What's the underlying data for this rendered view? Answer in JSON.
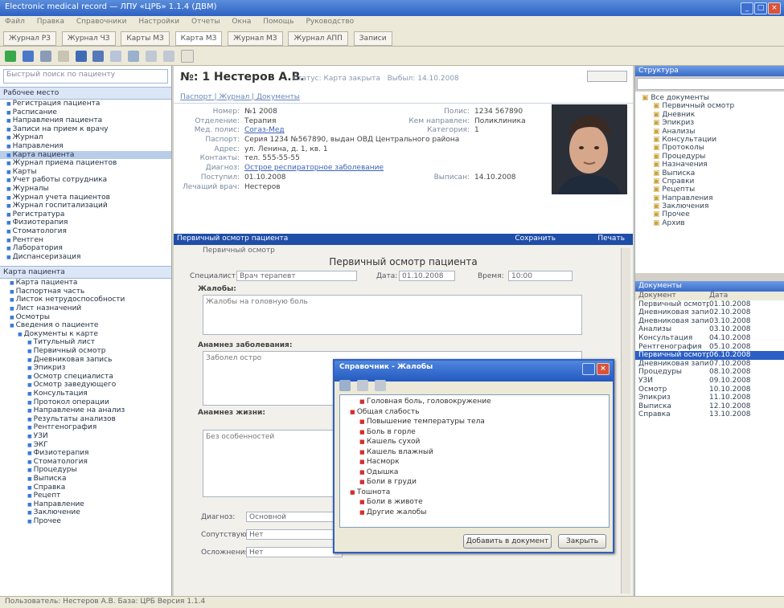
{
  "window": {
    "title": "Electronic medical record — ЛПУ «ЦРБ» 1.1.4 (ДВМ)"
  },
  "menu": [
    "Файл",
    "Правка",
    "Справочники",
    "Настройки",
    "Отчеты",
    "Окна",
    "Помощь",
    "Руководство"
  ],
  "tabs": [
    "Журнал РЗ",
    "Журнал ЧЗ",
    "Карты МЗ",
    "Карта МЗ",
    "Журнал МЗ",
    "Журнал АПП",
    "Записи"
  ],
  "left": {
    "search_placeholder": "Быстрый поиск по пациенту",
    "section_title": "Рабочее место",
    "nav_items": [
      "Регистрация пациента",
      "Расписание",
      "Направления пациента",
      "Записи на прием к врачу",
      "Журнал",
      "Направления",
      "Карта пациента",
      "Журнал приема пациентов",
      "Карты",
      "Учет работы сотрудника",
      "Журналы",
      "Журнал учета пациентов",
      "Журнал госпитализаций",
      "Регистратура",
      "Физиотерапия",
      "Стоматология",
      "Рентген",
      "Лаборатория",
      "Диспансеризация"
    ],
    "selected_nav_index": 6,
    "tree_header": "Карта пациента",
    "tree_items": [
      {
        "label": "Карта пациента",
        "level": 1
      },
      {
        "label": "Паспортная часть",
        "level": 1
      },
      {
        "label": "Листок нетрудоспособности",
        "level": 1
      },
      {
        "label": "Лист назначений",
        "level": 1
      },
      {
        "label": "Осмотры",
        "level": 1
      },
      {
        "label": "Сведения о пациенте",
        "level": 1
      },
      {
        "label": "Документы к карте",
        "level": 2
      },
      {
        "label": "Титульный лист",
        "level": 3
      },
      {
        "label": "Первичный осмотр",
        "level": 3
      },
      {
        "label": "Дневниковая запись",
        "level": 3
      },
      {
        "label": "Эпикриз",
        "level": 3
      },
      {
        "label": "Осмотр специалиста",
        "level": 3
      },
      {
        "label": "Осмотр заведующего",
        "level": 3
      },
      {
        "label": "Консультация",
        "level": 3
      },
      {
        "label": "Протокол операции",
        "level": 3
      },
      {
        "label": "Направление на анализ",
        "level": 3
      },
      {
        "label": "Результаты анализов",
        "level": 3
      },
      {
        "label": "Рентгенография",
        "level": 3
      },
      {
        "label": "УЗИ",
        "level": 3
      },
      {
        "label": "ЭКГ",
        "level": 3
      },
      {
        "label": "Физиотерапия",
        "level": 3
      },
      {
        "label": "Стоматология",
        "level": 3
      },
      {
        "label": "Процедуры",
        "level": 3
      },
      {
        "label": "Выписка",
        "level": 3
      },
      {
        "label": "Справка",
        "level": 3
      },
      {
        "label": "Рецепт",
        "level": 3
      },
      {
        "label": "Направление",
        "level": 3
      },
      {
        "label": "Заключение",
        "level": 3
      },
      {
        "label": "Прочее",
        "level": 3
      }
    ]
  },
  "card": {
    "title": "№: 1 Нестеров А.В.",
    "status_label": "Статус:",
    "status_value": "Карта закрыта",
    "date_label": "Выбыл:",
    "date_value": "14.10.2008",
    "tabs": [
      "Паспорт",
      "Журнал",
      "Документы"
    ],
    "rows": [
      {
        "label": "Номер:",
        "value": "№1 2008",
        "extra_label": "Полис:",
        "extra_value": "1234 567890"
      },
      {
        "label": "Отделение:",
        "value": "Терапия",
        "extra_label": "Кем направлен:",
        "extra_value": "Поликлиника"
      },
      {
        "label": "Мед. полис:",
        "value": "Согаз-Мед",
        "extra_label": "Категория:",
        "extra_value": "1"
      },
      {
        "label": "Паспорт:",
        "value": "Серия 1234 №567890, выдан ОВД Центрального района"
      },
      {
        "label": "Адрес:",
        "value": "ул. Ленина, д. 1, кв. 1"
      },
      {
        "label": "Контакты:",
        "value": "тел. 555-55-55"
      },
      {
        "label": "Диагноз:",
        "value": "Острое респираторное заболевание"
      },
      {
        "label": "Поступил:",
        "value": "01.10.2008",
        "extra_label": "Выписан:",
        "extra_value": "14.10.2008"
      },
      {
        "label": "Лечащий врач:",
        "value": "Нестеров"
      }
    ]
  },
  "document": {
    "band_title": "Первичный осмотр пациента",
    "band_right_1": "Сохранить",
    "band_right_2": "Печать",
    "subtitle": "Первичный осмотр",
    "heading": "Первичный осмотр пациента",
    "fields": [
      {
        "label": "Специалист:",
        "value": "Врач терапевт"
      },
      {
        "label": "Дата:",
        "value": "01.10.2008"
      },
      {
        "label": "Время:",
        "value": "10:00"
      }
    ],
    "complaints_label": "Жалобы:",
    "complaints_text": "Жалобы на головную боль",
    "history_label": "Анамнез заболевания:",
    "history_text": "Заболел остро",
    "life_label": "Анамнез жизни:",
    "life_text": "Без особенностей",
    "bottom_fields": [
      {
        "label": "Диагноз:",
        "value": "Основной"
      },
      {
        "label": "Сопутствующий:",
        "value": "Нет"
      },
      {
        "label": "Осложнения:",
        "value": "Нет"
      }
    ]
  },
  "right": {
    "tree_title": "Структура",
    "tree_items": [
      "Все документы",
      "Первичный осмотр",
      "Дневник",
      "Эпикриз",
      "Анализы",
      "Консультации",
      "Протоколы",
      "Процедуры",
      "Назначения",
      "Выписка",
      "Справки",
      "Рецепты",
      "Направления",
      "Заключения",
      "Прочее",
      "Архив"
    ],
    "list_title": "Документы",
    "list_col_a": "Документ",
    "list_col_b": "Дата",
    "list_rows": [
      {
        "a": "Первичный осмотр",
        "b": "01.10.2008"
      },
      {
        "a": "Дневниковая запись",
        "b": "02.10.2008"
      },
      {
        "a": "Дневниковая запись",
        "b": "03.10.2008"
      },
      {
        "a": "Анализы",
        "b": "03.10.2008"
      },
      {
        "a": "Консультация",
        "b": "04.10.2008"
      },
      {
        "a": "Рентгенография",
        "b": "05.10.2008"
      },
      {
        "a": "Первичный осмотр",
        "b": "06.10.2008"
      },
      {
        "a": "Дневниковая запись",
        "b": "07.10.2008"
      },
      {
        "a": "Процедуры",
        "b": "08.10.2008"
      },
      {
        "a": "УЗИ",
        "b": "09.10.2008"
      },
      {
        "a": "Осмотр",
        "b": "10.10.2008"
      },
      {
        "a": "Эпикриз",
        "b": "11.10.2008"
      },
      {
        "a": "Выписка",
        "b": "12.10.2008"
      },
      {
        "a": "Справка",
        "b": "13.10.2008"
      }
    ],
    "selected_row": 6
  },
  "dialog": {
    "title": "Справочник - Жалобы",
    "items": [
      "Головная боль, головокружение",
      "Общая слабость",
      "Повышение температуры тела",
      "Боль в горле",
      "Кашель сухой",
      "Кашель влажный",
      "Насморк",
      "Одышка",
      "Боли в груди",
      "Тошнота",
      "Боли в животе",
      "Другие жалобы"
    ],
    "ok_label": "Добавить в документ",
    "cancel_label": "Закрыть"
  },
  "status_bar": "Пользователь: Нестеров А.В.   База: ЦРБ   Версия 1.1.4"
}
